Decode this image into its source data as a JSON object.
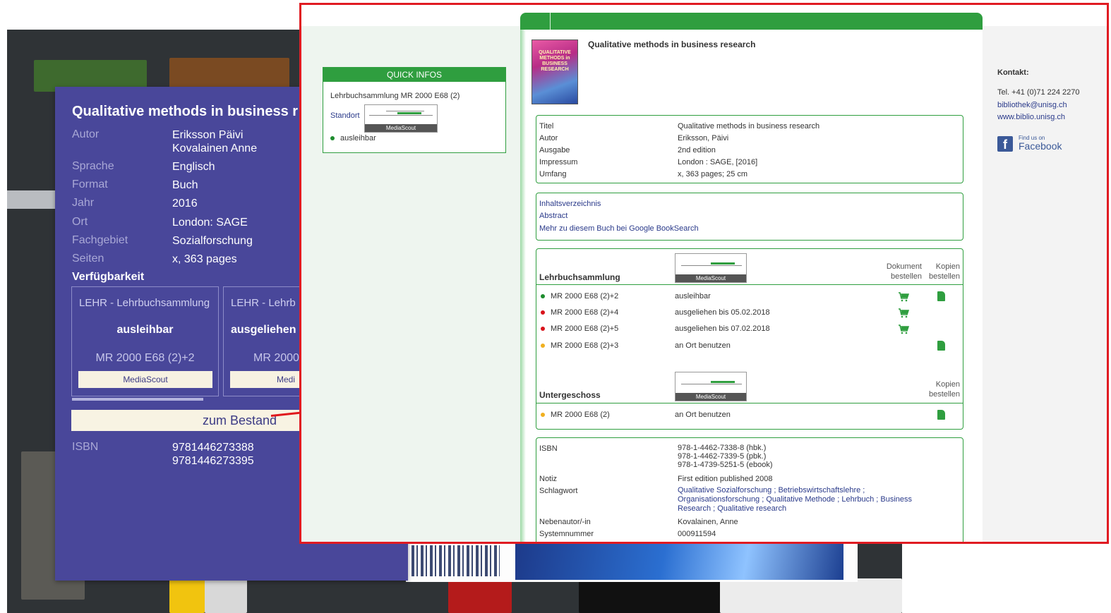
{
  "catalog_card": {
    "title": "Qualitative methods in business r",
    "fields": [
      {
        "label": "Autor",
        "value": "Eriksson Päivi",
        "value2": "Kovalainen Anne"
      },
      {
        "label": "Sprache",
        "value": "Englisch"
      },
      {
        "label": "Format",
        "value": "Buch"
      },
      {
        "label": "Jahr",
        "value": "2016"
      },
      {
        "label": "Ort",
        "value": "London: SAGE"
      },
      {
        "label": "Fachgebiet",
        "value": "Sozialforschung"
      },
      {
        "label": "Seiten",
        "value": "x, 363 pages"
      }
    ],
    "availability_heading": "Verfügbarkeit",
    "availability": [
      {
        "location": "LEHR - Lehrbuchsammlung",
        "status": "ausleihbar",
        "signature": "MR 2000 E68 (2)+2",
        "button": "MediaScout"
      },
      {
        "location": "LEHR - Lehrb",
        "status": "ausgeliehen b",
        "signature": "MR 2000",
        "button": "Medi"
      }
    ],
    "bestand_button": "zum Bestand",
    "isbn_label": "ISBN",
    "isbn_values": [
      "9781446273388",
      "9781446273395"
    ]
  },
  "web": {
    "quick_infos": {
      "header": "QUICK INFOS",
      "signature": "Lehrbuchsammlung MR 2000 E68 (2)",
      "standort": "Standort",
      "mediascout": "MediaScout",
      "status": "ausleihbar"
    },
    "book_title": "Qualitative methods in business research",
    "cover_text": "QUALITATIVE METHODS in BUSINESS RESEARCH",
    "details": [
      {
        "label": "Titel",
        "value": "Qualitative methods in business research"
      },
      {
        "label": "Autor",
        "value": "Eriksson, Päivi"
      },
      {
        "label": "Ausgabe",
        "value": "2nd edition"
      },
      {
        "label": "Impressum",
        "value": "London : SAGE, [2016]"
      },
      {
        "label": "Umfang",
        "value": "x, 363 pages; 25 cm"
      }
    ],
    "links": [
      "Inhaltsverzeichnis",
      "Abstract",
      "Mehr zu diesem Buch bei Google BookSearch"
    ],
    "holdings": {
      "section1": "Lehrbuchsammlung",
      "col_dokument": "Dokument bestellen",
      "col_kopien": "Kopien bestellen",
      "mediascout": "MediaScout",
      "rows": [
        {
          "signature": "MR 2000 E68 (2)+2",
          "status": "ausleihbar",
          "dot_color": "#1e8c2e"
        },
        {
          "signature": "MR 2000 E68 (2)+4",
          "status": "ausgeliehen bis 05.02.2018",
          "dot_color": "#d8131b"
        },
        {
          "signature": "MR 2000 E68 (2)+5",
          "status": "ausgeliehen bis 07.02.2018",
          "dot_color": "#d8131b"
        },
        {
          "signature": "MR 2000 E68 (2)+3",
          "status": "an Ort benutzen",
          "dot_color": "#f0b020"
        }
      ],
      "section2": "Untergeschoss",
      "rows2": [
        {
          "signature": "MR 2000 E68 (2)",
          "status": "an Ort benutzen",
          "dot_color": "#f0b020"
        }
      ]
    },
    "metadata": [
      {
        "label": "ISBN",
        "value": "978-1-4462-7338-8 (hbk.)",
        "value2": "978-1-4462-7339-5 (pbk.)",
        "value3": "978-1-4739-5251-5 (ebook)"
      },
      {
        "label": "Notiz",
        "value": "First edition published 2008"
      },
      {
        "label": "Schlagwort",
        "value": "Qualitative Sozialforschung ; Betriebswirtschaftslehre ;",
        "value2": "Organisationsforschung ; Qualitative Methode ; Lehrbuch ; Business",
        "value3": "Research ; Qualitative research"
      },
      {
        "label": "Nebenautor/-in",
        "value": "Kovalainen, Anne"
      },
      {
        "label": "Systemnummer",
        "value": "000911594"
      }
    ],
    "contact": {
      "heading": "Kontakt:",
      "phone": "Tel. +41 (0)71 224 2270",
      "email": "bibliothek@unisg.ch",
      "web": "www.biblio.unisg.ch",
      "fb_small": "Find us on",
      "fb_big": "Facebook"
    }
  },
  "colors": {
    "card_bg": "#49479a",
    "accent_green": "#2f9e3f",
    "highlight_red": "#e01b22"
  },
  "icons": [
    "cart-icon",
    "document-icon",
    "facebook-icon",
    "arrow-icon"
  ]
}
